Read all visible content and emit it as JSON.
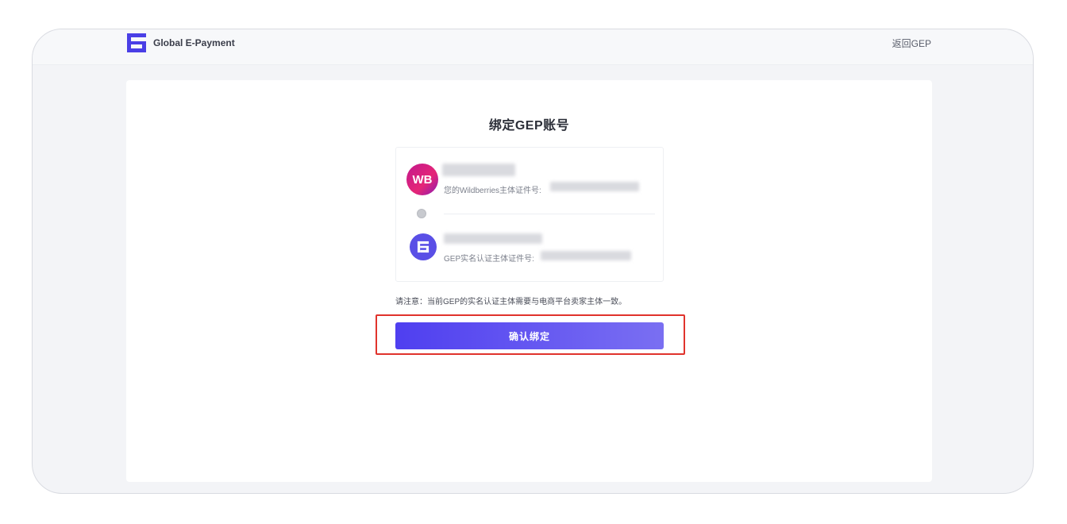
{
  "header": {
    "brand": "Global E-Payment",
    "back_link": "返回GEP",
    "logo_icon": "gep-logo-icon"
  },
  "page": {
    "title": "绑定GEP账号"
  },
  "bind_card": {
    "wildberries": {
      "avatar_text": "WB",
      "id_label": "您的Wildberries主体证件号:"
    },
    "gep": {
      "avatar_icon": "gep-logo-icon",
      "id_label": "GEP实名认证主体证件号:"
    },
    "link_icon": "link-dot-icon"
  },
  "note": "请注意：当前GEP的实名认证主体需要与电商平台卖家主体一致。",
  "confirm_button": "确认绑定",
  "colors": {
    "primary": "#5545ee",
    "highlight": "#e0332c",
    "wb_gradient": "#c2188d",
    "frame_bg": "#f3f4f7"
  }
}
